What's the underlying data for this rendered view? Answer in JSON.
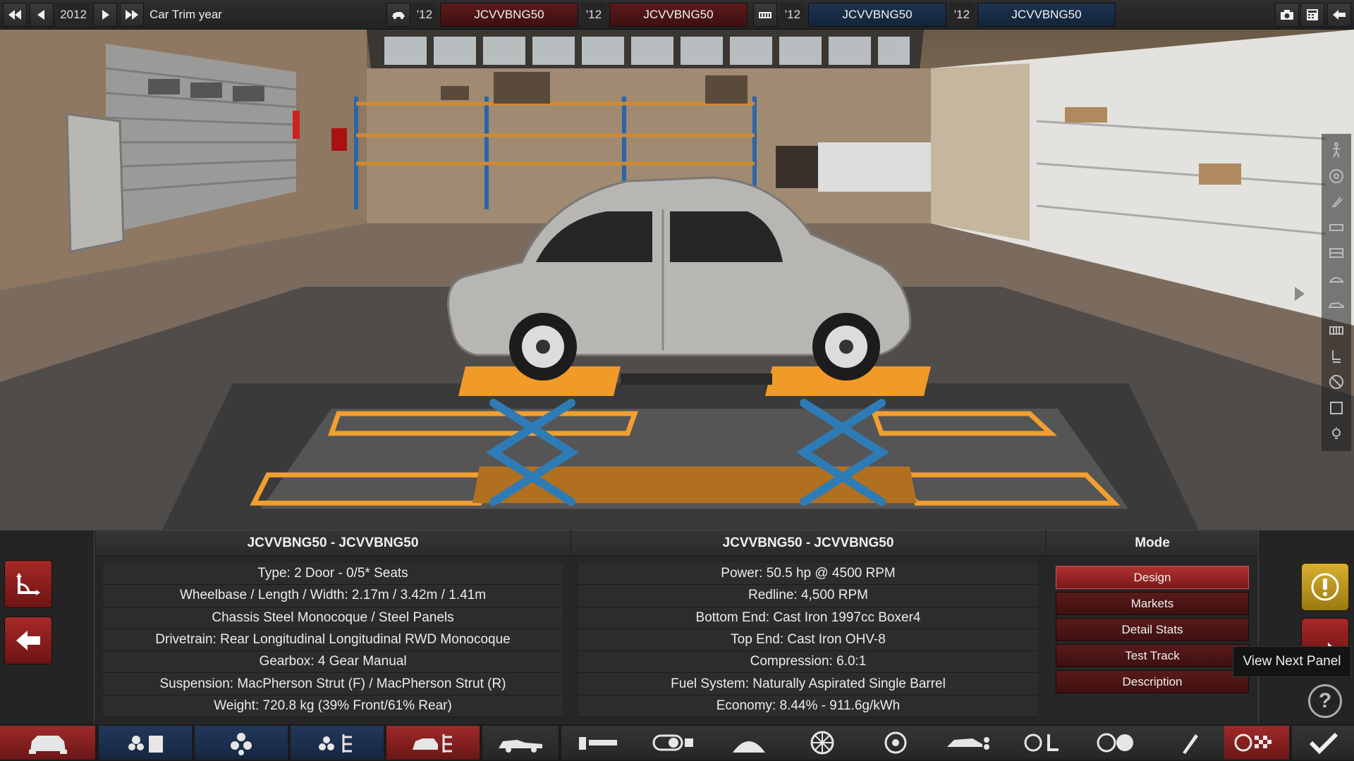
{
  "topbar": {
    "year": "2012",
    "trim_label": "Car Trim year",
    "slots": [
      {
        "year": "'12",
        "name": "JCVVBNG50"
      },
      {
        "year": "'12",
        "name": "JCVVBNG50"
      },
      {
        "year": "'12",
        "name": "JCVVBNG50"
      },
      {
        "year": "'12",
        "name": "JCVVBNG50"
      }
    ]
  },
  "panel": {
    "left_title": "JCVVBNG50 - JCVVBNG50",
    "left_stats": [
      "Type: 2 Door - 0/5* Seats",
      "Wheelbase / Length / Width: 2.17m / 3.42m / 1.41m",
      "Chassis Steel Monocoque / Steel Panels",
      "Drivetrain: Rear Longitudinal Longitudinal RWD Monocoque",
      "Gearbox: 4 Gear Manual",
      "Suspension: MacPherson Strut (F) / MacPherson Strut (R)",
      "Weight: 720.8 kg (39% Front/61% Rear)"
    ],
    "mid_title": "JCVVBNG50 - JCVVBNG50",
    "mid_stats": [
      "Power: 50.5 hp @ 4500 RPM",
      "Redline:  4,500 RPM",
      "Bottom End: Cast Iron 1997cc Boxer4",
      "Top End: Cast Iron OHV-8",
      "Compression: 6.0:1",
      "Fuel System: Naturally Aspirated Single Barrel",
      "Economy: 8.44% - 911.6g/kWh"
    ],
    "mode_title": "Mode",
    "modes": [
      "Design",
      "Markets",
      "Detail Stats",
      "Test Track",
      "Description"
    ],
    "tooltip": "View Next Panel",
    "help": "?"
  },
  "colors": {
    "accent_red": "#b03030",
    "accent_blue": "#22385a",
    "lift_orange": "#f0a030"
  }
}
